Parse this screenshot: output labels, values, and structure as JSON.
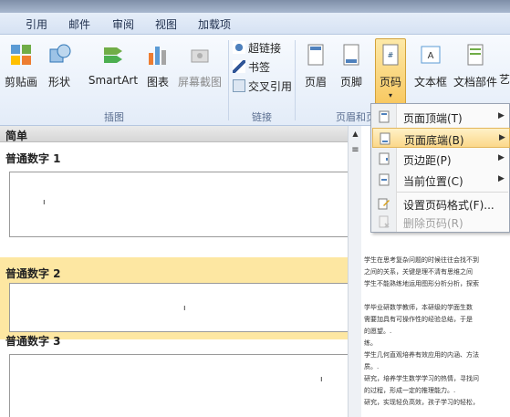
{
  "tabs": [
    "引用",
    "邮件",
    "审阅",
    "视图",
    "加载项"
  ],
  "ribbon": {
    "buttons": [
      {
        "label": "剪贴画"
      },
      {
        "label": "形状"
      },
      {
        "label": "SmartArt"
      },
      {
        "label": "图表"
      },
      {
        "label": "屏幕截图"
      },
      {
        "label": "页眉"
      },
      {
        "label": "页脚"
      },
      {
        "label": "页码"
      },
      {
        "label": "文本框"
      },
      {
        "label": "文档部件"
      },
      {
        "label": "艺"
      }
    ],
    "links": [
      "超链接",
      "书签",
      "交叉引用"
    ],
    "groups": [
      "插图",
      "链接",
      "页眉和页"
    ]
  },
  "gallery": {
    "header": "简单",
    "items": [
      "普通数字 1",
      "普通数字 2",
      "普通数字 3"
    ],
    "mark": "ı"
  },
  "menu": {
    "items": [
      {
        "label": "页面顶端(T)"
      },
      {
        "label": "页面底端(B)"
      },
      {
        "label": "页边距(P)"
      },
      {
        "label": "当前位置(C)"
      },
      {
        "label": "设置页码格式(F)..."
      },
      {
        "label": "删除页码(R)"
      }
    ]
  },
  "doc": {
    "lines": [
      "学生在思考复杂问题的时候往往会找不到",
      "之间的关系，关键是理不清有思维之间",
      "学生不能熟练地运用图形分析分析，探索",
      "",
      "学毕业研数学教师，本研级的学面生数",
      "需要加具有可操作性的经验总结，于是",
      "的愿望。.",
      "练。",
      "学生几何直观培养有效应用的内涵、方法",
      "质。.",
      "研究，培养学生数学学习的热情，寻找问",
      "的过程，形成一定的推理能力。.",
      "研究，实现轻负高效，孩子学习的轻松，"
    ]
  }
}
